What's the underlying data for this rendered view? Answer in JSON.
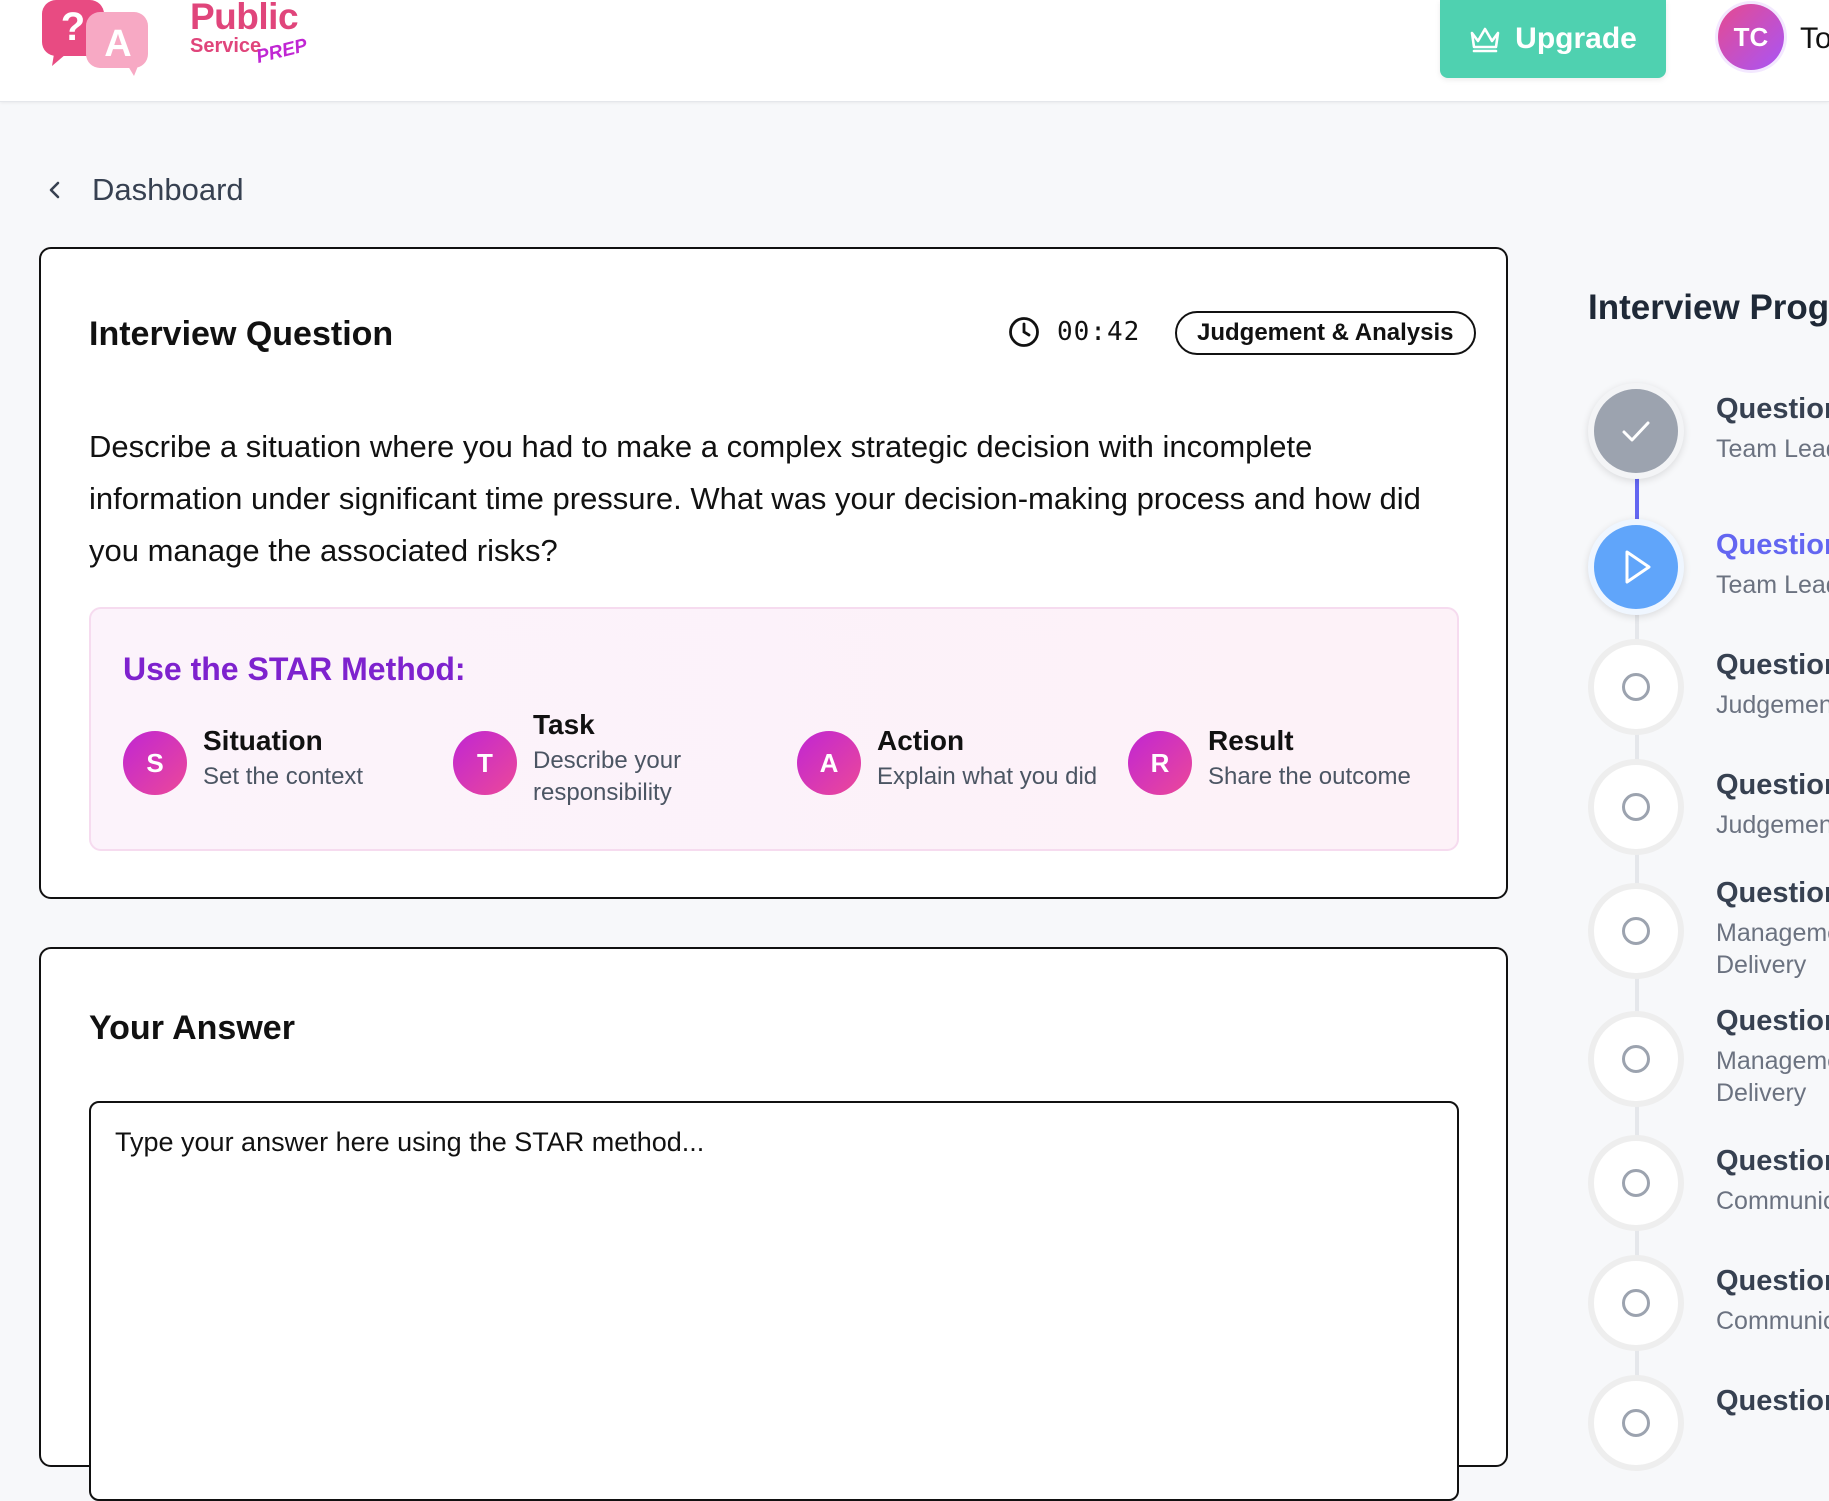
{
  "header": {
    "logo": {
      "public": "Public",
      "service": "Service",
      "prep": "PREP"
    },
    "upgrade_label": "Upgrade",
    "avatar_initials": "TC",
    "user_name_partial": "To"
  },
  "breadcrumb": {
    "label": "Dashboard"
  },
  "question_card": {
    "title": "Interview Question",
    "timer": "00:42",
    "category": "Judgement & Analysis",
    "question_text": "Describe a situation where you had to make a complex strategic decision with incomplete information under significant time pressure. What was your decision-making process and how did you manage the associated risks?",
    "star": {
      "title": "Use the STAR Method:",
      "items": [
        {
          "letter": "S",
          "name": "Situation",
          "desc": "Set the context"
        },
        {
          "letter": "T",
          "name": "Task",
          "desc": "Describe your responsibility"
        },
        {
          "letter": "A",
          "name": "Action",
          "desc": "Explain what you did"
        },
        {
          "letter": "R",
          "name": "Result",
          "desc": "Share the outcome"
        }
      ]
    }
  },
  "answer_card": {
    "title": "Your Answer",
    "placeholder": "Type your answer here using the STAR method..."
  },
  "progress": {
    "title": "Interview Prog",
    "steps": [
      {
        "label": "Question",
        "sub": "Team Lead",
        "status": "done",
        "icon": "check-icon"
      },
      {
        "label": "Question",
        "sub": "Team Lead",
        "status": "active",
        "icon": "play-icon"
      },
      {
        "label": "Question",
        "sub": "Judgement",
        "status": "pending",
        "icon": "circle-icon"
      },
      {
        "label": "Question",
        "sub": "Judgement",
        "status": "pending",
        "icon": "circle-icon"
      },
      {
        "label": "Question",
        "sub": "Manageme",
        "sub2": "Delivery",
        "status": "pending",
        "icon": "circle-icon"
      },
      {
        "label": "Question",
        "sub": "Manageme",
        "sub2": "Delivery",
        "status": "pending",
        "icon": "circle-icon"
      },
      {
        "label": "Question",
        "sub": "Communic",
        "status": "pending",
        "icon": "circle-icon"
      },
      {
        "label": "Question",
        "sub": "Communic",
        "status": "pending",
        "icon": "circle-icon"
      },
      {
        "label": "Question",
        "sub": "",
        "status": "pending",
        "icon": "circle-icon"
      }
    ]
  },
  "colors": {
    "brand_pink": "#e0457b",
    "upgrade_green": "#4fd1b0",
    "star_purple": "#7e22ce",
    "progress_active": "#6366f1",
    "step_active_fill": "#60a5fa",
    "step_done_fill": "#9ca3af"
  }
}
